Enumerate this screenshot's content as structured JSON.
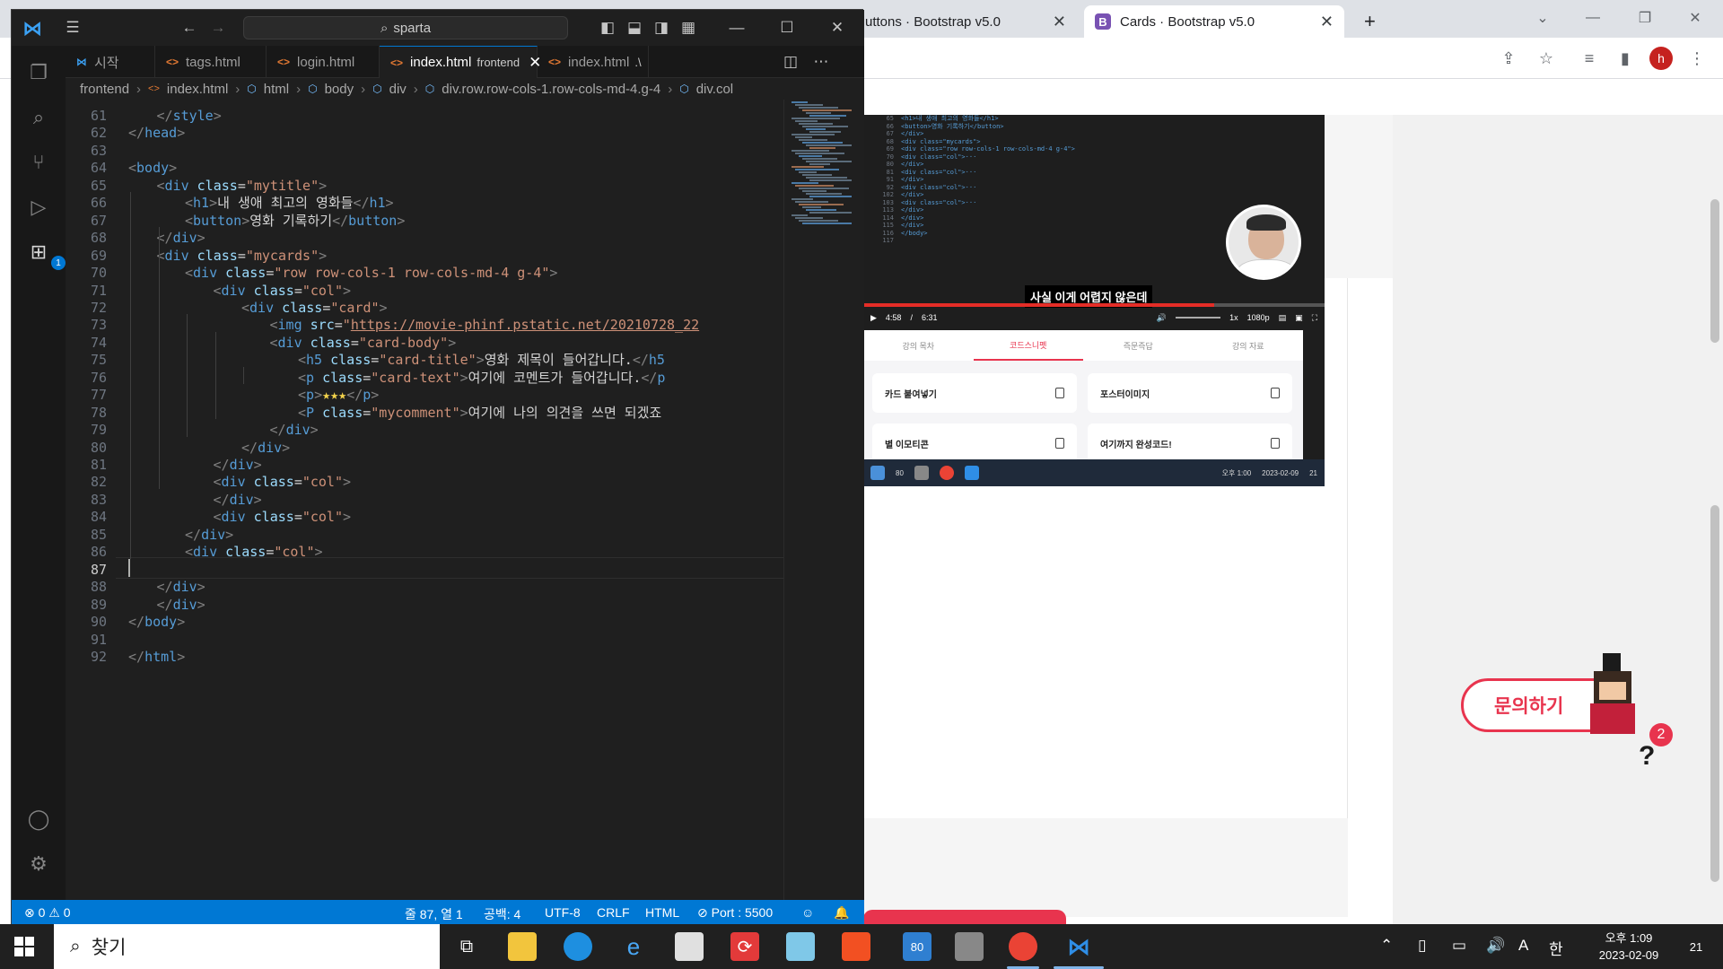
{
  "browser": {
    "tab1_title": "uttons · Bootstrap v5.0",
    "tab2_title": "Cards · Bootstrap v5.0",
    "tab2_favicon": "B",
    "tab_close": "✕",
    "new_tab": "+",
    "profile_initial": "h"
  },
  "lecture": {
    "subtitle": "사실 이게 어렵지 않은데",
    "time_current": "4:58",
    "time_separator": "/",
    "time_total": "6:31",
    "speed": "1x",
    "quality": "1080p",
    "progress_fraction": 0.76,
    "tabs": [
      "강의 목차",
      "코드스니펫",
      "즉문즉답",
      "강의 자료"
    ],
    "active_tab_index": 1,
    "snippets": [
      "카드 붙여넣기",
      "포스터이미지",
      "별 이모티콘",
      "여기까지 완성코드!"
    ],
    "mini_taskbar_clock": "오후 1:00",
    "mini_taskbar_date": "2023-02-09",
    "mini_taskbar_badge": "21",
    "mini_mail_badge": "80",
    "code_lines": [
      {
        "n": "65",
        "t": "<h1>내 생애 최고의 영화들</h1>"
      },
      {
        "n": "66",
        "t": "<button>영화 기록하기</button>"
      },
      {
        "n": "67",
        "t": "</div>"
      },
      {
        "n": "68",
        "t": "<div class=\"mycards\">"
      },
      {
        "n": "69",
        "t": "<div class=\"row row-cols-1 row-cols-md-4 g-4\">"
      },
      {
        "n": "70",
        "t": "<div class=\"col\">···"
      },
      {
        "n": "80",
        "t": "</div>"
      },
      {
        "n": "81",
        "t": "<div class=\"col\">···"
      },
      {
        "n": "91",
        "t": "</div>"
      },
      {
        "n": "92",
        "t": "<div class=\"col\">···"
      },
      {
        "n": "102",
        "t": "</div>"
      },
      {
        "n": "103",
        "t": "<div class=\"col\">···"
      },
      {
        "n": "113",
        "t": "</div>"
      },
      {
        "n": "114",
        "t": "</div>"
      },
      {
        "n": "115",
        "t": "</div>"
      },
      {
        "n": "116",
        "t": "</body>"
      },
      {
        "n": "117",
        "t": ""
      }
    ]
  },
  "inquiry": {
    "label": "문의하기",
    "badge": "2",
    "question_mark": "?"
  },
  "vscode": {
    "search_text": "sparta",
    "tabs": [
      {
        "label": "시작",
        "icon": "vscode-icon"
      },
      {
        "label": "tags.html",
        "icon": "html-icon"
      },
      {
        "label": "login.html",
        "icon": "html-icon"
      },
      {
        "label": "index.html",
        "sub": "frontend",
        "icon": "html-icon",
        "active": true
      },
      {
        "label": "index.html",
        "sub": ".\\",
        "icon": "html-icon"
      }
    ],
    "breadcrumb": [
      "frontend",
      "index.html",
      "html",
      "body",
      "div",
      "div.row.row-cols-1.row-cols-md-4.g-4",
      "div.col"
    ],
    "current_line": 87,
    "lines": [
      {
        "n": 61,
        "indent": 1,
        "parts": [
          [
            "tg",
            "</"
          ],
          [
            "tn",
            "style"
          ],
          [
            "tg",
            ">"
          ]
        ]
      },
      {
        "n": 62,
        "indent": 0,
        "parts": [
          [
            "tg",
            "</"
          ],
          [
            "tn",
            "head"
          ],
          [
            "tg",
            ">"
          ]
        ]
      },
      {
        "n": 63,
        "indent": 0,
        "parts": []
      },
      {
        "n": 64,
        "indent": 0,
        "parts": [
          [
            "tg",
            "<"
          ],
          [
            "tn",
            "body"
          ],
          [
            "tg",
            ">"
          ]
        ]
      },
      {
        "n": 65,
        "indent": 1,
        "parts": [
          [
            "tg",
            "<"
          ],
          [
            "tn",
            "div"
          ],
          [
            "at",
            " class"
          ],
          [
            "txt",
            "="
          ],
          [
            "st",
            "\"mytitle\""
          ],
          [
            "tg",
            ">"
          ]
        ]
      },
      {
        "n": 66,
        "indent": 2,
        "parts": [
          [
            "tg",
            "<"
          ],
          [
            "tn",
            "h1"
          ],
          [
            "tg",
            ">"
          ],
          [
            "txt",
            "내 생애 최고의 영화들"
          ],
          [
            "tg",
            "</"
          ],
          [
            "tn",
            "h1"
          ],
          [
            "tg",
            ">"
          ]
        ]
      },
      {
        "n": 67,
        "indent": 2,
        "parts": [
          [
            "tg",
            "<"
          ],
          [
            "tn",
            "button"
          ],
          [
            "tg",
            ">"
          ],
          [
            "txt",
            "영화 기록하기"
          ],
          [
            "tg",
            "</"
          ],
          [
            "tn",
            "button"
          ],
          [
            "tg",
            ">"
          ]
        ]
      },
      {
        "n": 68,
        "indent": 1,
        "parts": [
          [
            "tg",
            "</"
          ],
          [
            "tn",
            "div"
          ],
          [
            "tg",
            ">"
          ]
        ]
      },
      {
        "n": 69,
        "indent": 1,
        "parts": [
          [
            "tg",
            "<"
          ],
          [
            "tn",
            "div"
          ],
          [
            "at",
            " class"
          ],
          [
            "txt",
            "="
          ],
          [
            "st",
            "\"mycards\""
          ],
          [
            "tg",
            ">"
          ]
        ]
      },
      {
        "n": 70,
        "indent": 2,
        "parts": [
          [
            "tg",
            "<"
          ],
          [
            "tn",
            "div"
          ],
          [
            "at",
            " class"
          ],
          [
            "txt",
            "="
          ],
          [
            "st",
            "\"row row-cols-1 row-cols-md-4 g-4\""
          ],
          [
            "tg",
            ">"
          ]
        ]
      },
      {
        "n": 71,
        "indent": 3,
        "parts": [
          [
            "tg",
            "<"
          ],
          [
            "tn",
            "div"
          ],
          [
            "at",
            " class"
          ],
          [
            "txt",
            "="
          ],
          [
            "st",
            "\"col\""
          ],
          [
            "tg",
            ">"
          ]
        ]
      },
      {
        "n": 72,
        "indent": 4,
        "parts": [
          [
            "tg",
            "<"
          ],
          [
            "tn",
            "div"
          ],
          [
            "at",
            " class"
          ],
          [
            "txt",
            "="
          ],
          [
            "st",
            "\"card\""
          ],
          [
            "tg",
            ">"
          ]
        ]
      },
      {
        "n": 73,
        "indent": 5,
        "parts": [
          [
            "tg",
            "<"
          ],
          [
            "tn",
            "img"
          ],
          [
            "at",
            " src"
          ],
          [
            "txt",
            "="
          ],
          [
            "st",
            "\""
          ],
          [
            "url",
            "https://movie-phinf.pstatic.net/20210728_22"
          ]
        ]
      },
      {
        "n": 74,
        "indent": 5,
        "parts": [
          [
            "tg",
            "<"
          ],
          [
            "tn",
            "div"
          ],
          [
            "at",
            " class"
          ],
          [
            "txt",
            "="
          ],
          [
            "st",
            "\"card-body\""
          ],
          [
            "tg",
            ">"
          ]
        ]
      },
      {
        "n": 75,
        "indent": 6,
        "parts": [
          [
            "tg",
            "<"
          ],
          [
            "tn",
            "h5"
          ],
          [
            "at",
            " class"
          ],
          [
            "txt",
            "="
          ],
          [
            "st",
            "\"card-title\""
          ],
          [
            "tg",
            ">"
          ],
          [
            "txt",
            "영화 제목이 들어갑니다."
          ],
          [
            "tg",
            "</"
          ],
          [
            "tn",
            "h5"
          ]
        ]
      },
      {
        "n": 76,
        "indent": 6,
        "parts": [
          [
            "tg",
            "<"
          ],
          [
            "tn",
            "p"
          ],
          [
            "at",
            " class"
          ],
          [
            "txt",
            "="
          ],
          [
            "st",
            "\"card-text\""
          ],
          [
            "tg",
            ">"
          ],
          [
            "txt",
            "여기에 코멘트가 들어갑니다."
          ],
          [
            "tg",
            "</"
          ],
          [
            "tn",
            "p"
          ]
        ]
      },
      {
        "n": 77,
        "indent": 6,
        "parts": [
          [
            "tg",
            "<"
          ],
          [
            "tn",
            "p"
          ],
          [
            "tg",
            ">"
          ],
          [
            "star",
            "★★★"
          ],
          [
            "tg",
            "</"
          ],
          [
            "tn",
            "p"
          ],
          [
            "tg",
            ">"
          ]
        ]
      },
      {
        "n": 78,
        "indent": 6,
        "parts": [
          [
            "tg",
            "<"
          ],
          [
            "tn",
            "P"
          ],
          [
            "at",
            " class"
          ],
          [
            "txt",
            "="
          ],
          [
            "st",
            "\"mycomment\""
          ],
          [
            "tg",
            ">"
          ],
          [
            "txt",
            "여기에 나의 의견을 쓰면 되겠죠"
          ]
        ]
      },
      {
        "n": 79,
        "indent": 5,
        "parts": [
          [
            "tg",
            "</"
          ],
          [
            "tn",
            "div"
          ],
          [
            "tg",
            ">"
          ]
        ]
      },
      {
        "n": 80,
        "indent": 4,
        "parts": [
          [
            "tg",
            "</"
          ],
          [
            "tn",
            "div"
          ],
          [
            "tg",
            ">"
          ]
        ]
      },
      {
        "n": 81,
        "indent": 3,
        "parts": [
          [
            "tg",
            "</"
          ],
          [
            "tn",
            "div"
          ],
          [
            "tg",
            ">"
          ]
        ]
      },
      {
        "n": 82,
        "indent": 3,
        "parts": [
          [
            "tg",
            "<"
          ],
          [
            "tn",
            "div"
          ],
          [
            "at",
            " class"
          ],
          [
            "txt",
            "="
          ],
          [
            "st",
            "\"col\""
          ],
          [
            "tg",
            ">"
          ]
        ]
      },
      {
        "n": 83,
        "indent": 3,
        "parts": [
          [
            "tg",
            "</"
          ],
          [
            "tn",
            "div"
          ],
          [
            "tg",
            ">"
          ]
        ]
      },
      {
        "n": 84,
        "indent": 3,
        "parts": [
          [
            "tg",
            "<"
          ],
          [
            "tn",
            "div"
          ],
          [
            "at",
            " class"
          ],
          [
            "txt",
            "="
          ],
          [
            "st",
            "\"col\""
          ],
          [
            "tg",
            ">"
          ]
        ]
      },
      {
        "n": 85,
        "indent": 2,
        "parts": [
          [
            "tg",
            "</"
          ],
          [
            "tn",
            "div"
          ],
          [
            "tg",
            ">"
          ]
        ]
      },
      {
        "n": 86,
        "indent": 2,
        "parts": [
          [
            "tg",
            "<"
          ],
          [
            "tn",
            "div"
          ],
          [
            "at",
            " class"
          ],
          [
            "txt",
            "="
          ],
          [
            "st",
            "\"col\""
          ],
          [
            "tg",
            ">"
          ]
        ]
      },
      {
        "n": 87,
        "indent": 0,
        "parts": []
      },
      {
        "n": 88,
        "indent": 1,
        "parts": [
          [
            "tg",
            "</"
          ],
          [
            "tn",
            "div"
          ],
          [
            "tg",
            ">"
          ]
        ]
      },
      {
        "n": 89,
        "indent": 1,
        "parts": [
          [
            "tg",
            "</"
          ],
          [
            "tn",
            "div"
          ],
          [
            "tg",
            ">"
          ]
        ]
      },
      {
        "n": 90,
        "indent": 0,
        "parts": [
          [
            "tg",
            "</"
          ],
          [
            "tn",
            "body"
          ],
          [
            "tg",
            ">"
          ]
        ]
      },
      {
        "n": 91,
        "indent": 0,
        "parts": []
      },
      {
        "n": 92,
        "indent": 0,
        "parts": [
          [
            "tg",
            "</"
          ],
          [
            "tn",
            "html"
          ],
          [
            "tg",
            ">"
          ]
        ]
      }
    ],
    "status": {
      "errors": "0",
      "warnings": "0",
      "position": "줄 87, 열 1",
      "spaces": "공백: 4",
      "encoding": "UTF-8",
      "eol": "CRLF",
      "language": "HTML",
      "port": "Port : 5500"
    },
    "activity_badge": "1"
  },
  "taskbar": {
    "search_placeholder": "찾기",
    "mail_badge": "80",
    "ime": "A",
    "lang": "한",
    "time": "오후 1:09",
    "date": "2023-02-09",
    "notifications": "21"
  }
}
